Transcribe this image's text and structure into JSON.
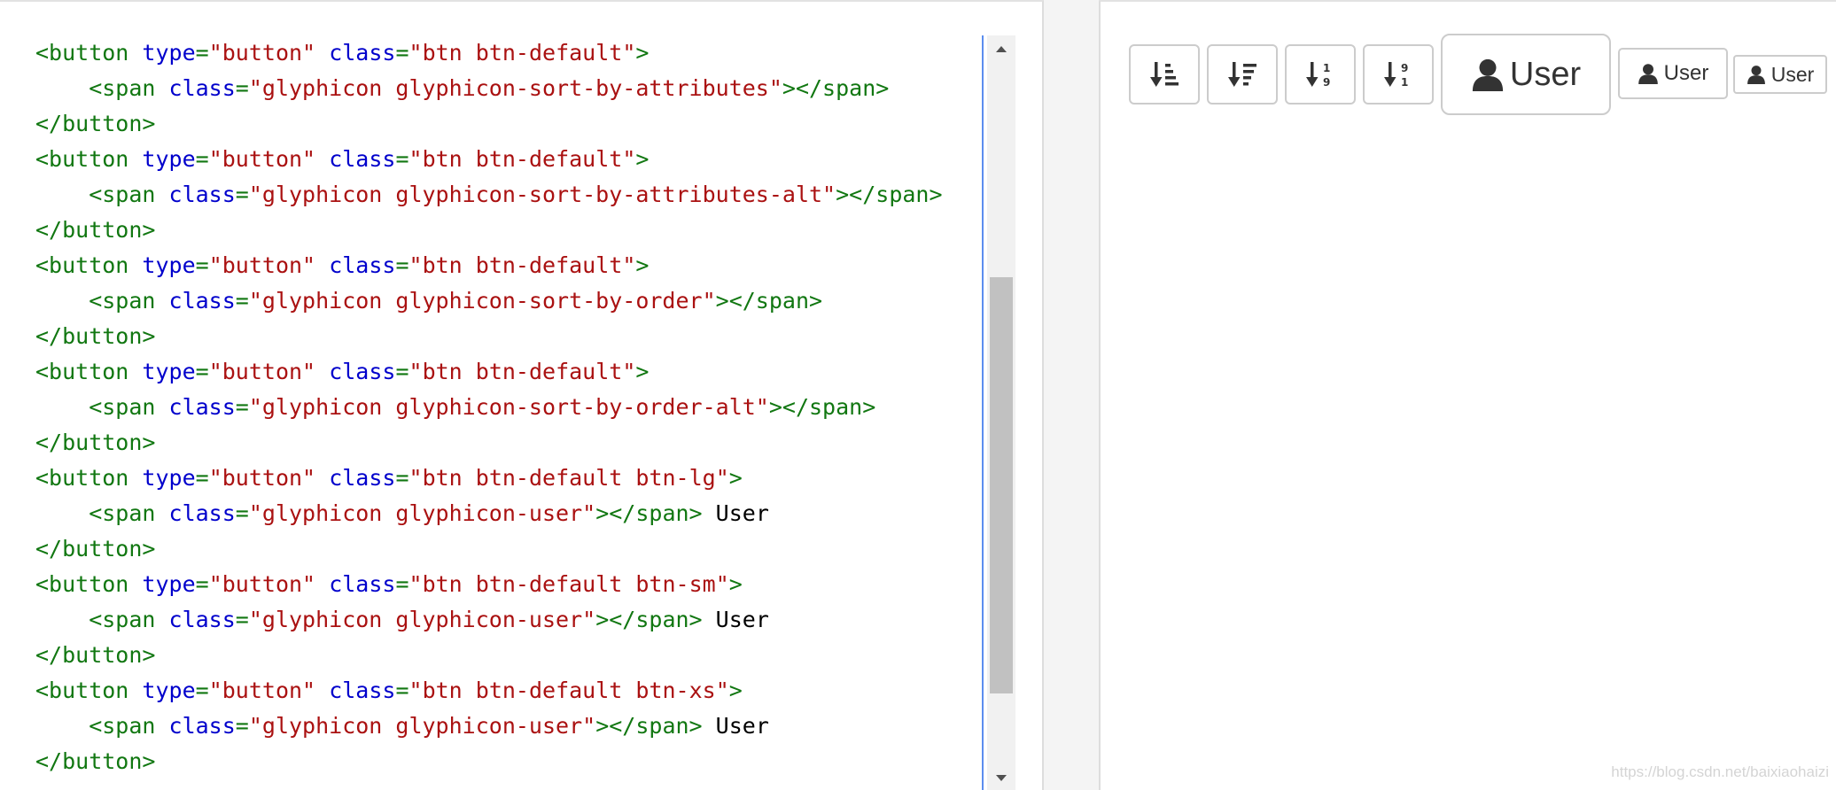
{
  "editor": {
    "lines": [
      [
        {
          "t": "tag",
          "v": "<button "
        },
        {
          "t": "attr",
          "v": "type"
        },
        {
          "t": "tag",
          "v": "="
        },
        {
          "t": "str",
          "v": "\"button\""
        },
        {
          "t": "tag",
          "v": " "
        },
        {
          "t": "attr",
          "v": "class"
        },
        {
          "t": "tag",
          "v": "="
        },
        {
          "t": "str",
          "v": "\"btn btn-default\""
        },
        {
          "t": "tag",
          "v": ">"
        }
      ],
      [
        {
          "t": "tag",
          "v": "    <span "
        },
        {
          "t": "attr",
          "v": "class"
        },
        {
          "t": "tag",
          "v": "="
        },
        {
          "t": "str",
          "v": "\"glyphicon glyphicon-sort-by-attributes\""
        },
        {
          "t": "tag",
          "v": "></span>"
        }
      ],
      [
        {
          "t": "tag",
          "v": "</button>"
        }
      ],
      [
        {
          "t": "tag",
          "v": "<button "
        },
        {
          "t": "attr",
          "v": "type"
        },
        {
          "t": "tag",
          "v": "="
        },
        {
          "t": "str",
          "v": "\"button\""
        },
        {
          "t": "tag",
          "v": " "
        },
        {
          "t": "attr",
          "v": "class"
        },
        {
          "t": "tag",
          "v": "="
        },
        {
          "t": "str",
          "v": "\"btn btn-default\""
        },
        {
          "t": "tag",
          "v": ">"
        }
      ],
      [
        {
          "t": "tag",
          "v": "    <span "
        },
        {
          "t": "attr",
          "v": "class"
        },
        {
          "t": "tag",
          "v": "="
        },
        {
          "t": "str",
          "v": "\"glyphicon glyphicon-sort-by-attributes-alt\""
        },
        {
          "t": "tag",
          "v": "></span>"
        }
      ],
      [
        {
          "t": "tag",
          "v": "</button>"
        }
      ],
      [
        {
          "t": "tag",
          "v": "<button "
        },
        {
          "t": "attr",
          "v": "type"
        },
        {
          "t": "tag",
          "v": "="
        },
        {
          "t": "str",
          "v": "\"button\""
        },
        {
          "t": "tag",
          "v": " "
        },
        {
          "t": "attr",
          "v": "class"
        },
        {
          "t": "tag",
          "v": "="
        },
        {
          "t": "str",
          "v": "\"btn btn-default\""
        },
        {
          "t": "tag",
          "v": ">"
        }
      ],
      [
        {
          "t": "tag",
          "v": "    <span "
        },
        {
          "t": "attr",
          "v": "class"
        },
        {
          "t": "tag",
          "v": "="
        },
        {
          "t": "str",
          "v": "\"glyphicon glyphicon-sort-by-order\""
        },
        {
          "t": "tag",
          "v": "></span>"
        }
      ],
      [
        {
          "t": "tag",
          "v": "</button>"
        }
      ],
      [
        {
          "t": "tag",
          "v": "<button "
        },
        {
          "t": "attr",
          "v": "type"
        },
        {
          "t": "tag",
          "v": "="
        },
        {
          "t": "str",
          "v": "\"button\""
        },
        {
          "t": "tag",
          "v": " "
        },
        {
          "t": "attr",
          "v": "class"
        },
        {
          "t": "tag",
          "v": "="
        },
        {
          "t": "str",
          "v": "\"btn btn-default\""
        },
        {
          "t": "tag",
          "v": ">"
        }
      ],
      [
        {
          "t": "tag",
          "v": "    <span "
        },
        {
          "t": "attr",
          "v": "class"
        },
        {
          "t": "tag",
          "v": "="
        },
        {
          "t": "str",
          "v": "\"glyphicon glyphicon-sort-by-order-alt\""
        },
        {
          "t": "tag",
          "v": "></span>"
        }
      ],
      [
        {
          "t": "tag",
          "v": "</button>"
        }
      ],
      [
        {
          "t": "tag",
          "v": "<button "
        },
        {
          "t": "attr",
          "v": "type"
        },
        {
          "t": "tag",
          "v": "="
        },
        {
          "t": "str",
          "v": "\"button\""
        },
        {
          "t": "tag",
          "v": " "
        },
        {
          "t": "attr",
          "v": "class"
        },
        {
          "t": "tag",
          "v": "="
        },
        {
          "t": "str",
          "v": "\"btn btn-default btn-lg\""
        },
        {
          "t": "tag",
          "v": ">"
        }
      ],
      [
        {
          "t": "tag",
          "v": "    <span "
        },
        {
          "t": "attr",
          "v": "class"
        },
        {
          "t": "tag",
          "v": "="
        },
        {
          "t": "str",
          "v": "\"glyphicon glyphicon-user\""
        },
        {
          "t": "tag",
          "v": "></span>"
        },
        {
          "t": "txt",
          "v": " User"
        }
      ],
      [
        {
          "t": "tag",
          "v": "</button>"
        }
      ],
      [
        {
          "t": "tag",
          "v": "<button "
        },
        {
          "t": "attr",
          "v": "type"
        },
        {
          "t": "tag",
          "v": "="
        },
        {
          "t": "str",
          "v": "\"button\""
        },
        {
          "t": "tag",
          "v": " "
        },
        {
          "t": "attr",
          "v": "class"
        },
        {
          "t": "tag",
          "v": "="
        },
        {
          "t": "str",
          "v": "\"btn btn-default btn-sm\""
        },
        {
          "t": "tag",
          "v": ">"
        }
      ],
      [
        {
          "t": "tag",
          "v": "    <span "
        },
        {
          "t": "attr",
          "v": "class"
        },
        {
          "t": "tag",
          "v": "="
        },
        {
          "t": "str",
          "v": "\"glyphicon glyphicon-user\""
        },
        {
          "t": "tag",
          "v": "></span>"
        },
        {
          "t": "txt",
          "v": " User"
        }
      ],
      [
        {
          "t": "tag",
          "v": "</button>"
        }
      ],
      [
        {
          "t": "tag",
          "v": "<button "
        },
        {
          "t": "attr",
          "v": "type"
        },
        {
          "t": "tag",
          "v": "="
        },
        {
          "t": "str",
          "v": "\"button\""
        },
        {
          "t": "tag",
          "v": " "
        },
        {
          "t": "attr",
          "v": "class"
        },
        {
          "t": "tag",
          "v": "="
        },
        {
          "t": "str",
          "v": "\"btn btn-default btn-xs\""
        },
        {
          "t": "tag",
          "v": ">"
        }
      ],
      [
        {
          "t": "tag",
          "v": "    <span "
        },
        {
          "t": "attr",
          "v": "class"
        },
        {
          "t": "tag",
          "v": "="
        },
        {
          "t": "str",
          "v": "\"glyphicon glyphicon-user\""
        },
        {
          "t": "tag",
          "v": "></span>"
        },
        {
          "t": "txt",
          "v": " User"
        }
      ],
      [
        {
          "t": "tag",
          "v": "</button>"
        }
      ]
    ],
    "colors": {
      "tag": "#117711",
      "attr": "#0000cc",
      "str": "#aa1111",
      "txt": "#000000"
    }
  },
  "scrollbar": {
    "up_icon": "triangle-up-icon",
    "down_icon": "triangle-down-icon"
  },
  "preview": {
    "buttons": [
      {
        "id": "sort-by-attributes",
        "icon": "sort-by-attributes-icon",
        "label": ""
      },
      {
        "id": "sort-by-attributes-alt",
        "icon": "sort-by-attributes-alt-icon",
        "label": ""
      },
      {
        "id": "sort-by-order",
        "icon": "sort-by-order-icon",
        "label": ""
      },
      {
        "id": "sort-by-order-alt",
        "icon": "sort-by-order-alt-icon",
        "label": ""
      },
      {
        "id": "user-lg",
        "icon": "user-icon",
        "label": "User"
      },
      {
        "id": "user-sm",
        "icon": "user-icon",
        "label": "User"
      },
      {
        "id": "user-xs",
        "icon": "user-icon",
        "label": "User"
      }
    ]
  },
  "watermark": "https://blog.csdn.net/baixiaohaizi"
}
